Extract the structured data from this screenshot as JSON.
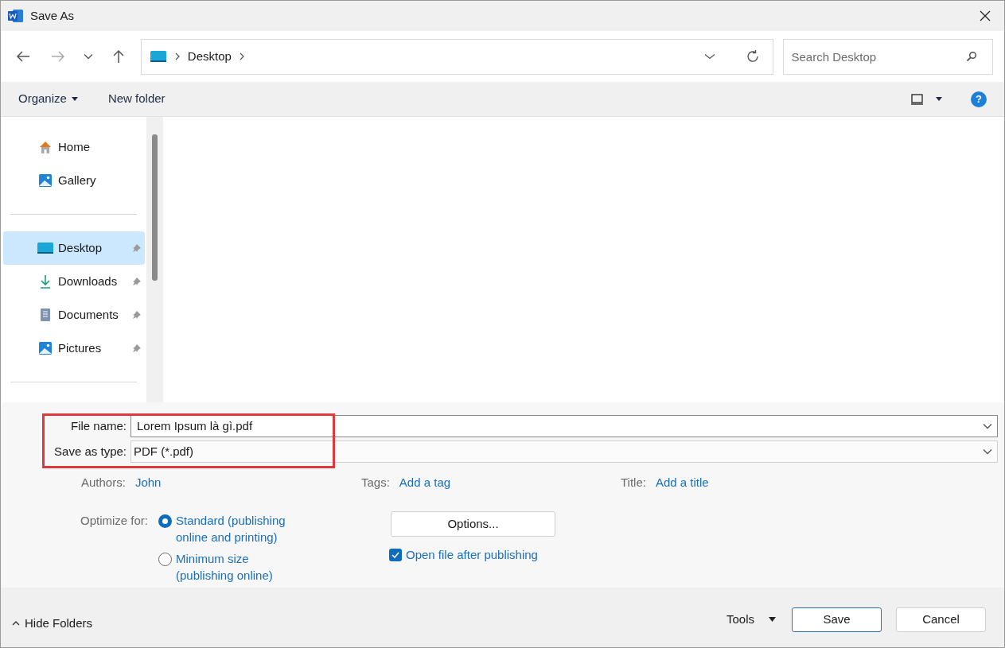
{
  "window": {
    "title": "Save As"
  },
  "address": {
    "path": [
      "Desktop"
    ]
  },
  "search": {
    "placeholder": "Search Desktop"
  },
  "toolbar": {
    "organize": "Organize",
    "new_folder": "New folder",
    "help": "?"
  },
  "sidebar": {
    "groups": [
      [
        {
          "kind": "home",
          "label": "Home",
          "selected": false,
          "pinned": false
        },
        {
          "kind": "gallery",
          "label": "Gallery",
          "selected": false,
          "pinned": false
        }
      ],
      [
        {
          "kind": "desktop",
          "label": "Desktop",
          "selected": true,
          "pinned": true
        },
        {
          "kind": "downloads",
          "label": "Downloads",
          "selected": false,
          "pinned": true
        },
        {
          "kind": "documents",
          "label": "Documents",
          "selected": false,
          "pinned": true
        },
        {
          "kind": "pictures",
          "label": "Pictures",
          "selected": false,
          "pinned": true
        }
      ]
    ]
  },
  "form": {
    "file_name": {
      "label": "File name:",
      "value": "Lorem Ipsum là gì.pdf"
    },
    "save_as_type": {
      "label": "Save as type:",
      "value": "PDF (*.pdf)"
    },
    "meta": [
      {
        "label": "Authors:",
        "value": "John"
      },
      {
        "label": "Tags:",
        "value": "Add a tag"
      },
      {
        "label": "Title:",
        "value": "Add a title"
      }
    ],
    "optimize": {
      "label": "Optimize for:",
      "options": [
        {
          "label": "Standard (publishing online and printing)",
          "selected": true
        },
        {
          "label": "Minimum size (publishing online)",
          "selected": false
        }
      ]
    },
    "options_button": "Options...",
    "open_after": {
      "label": "Open file after publishing",
      "checked": true
    }
  },
  "footer": {
    "hide_folders": "Hide Folders",
    "tools": "Tools",
    "save": "Save",
    "cancel": "Cancel"
  }
}
